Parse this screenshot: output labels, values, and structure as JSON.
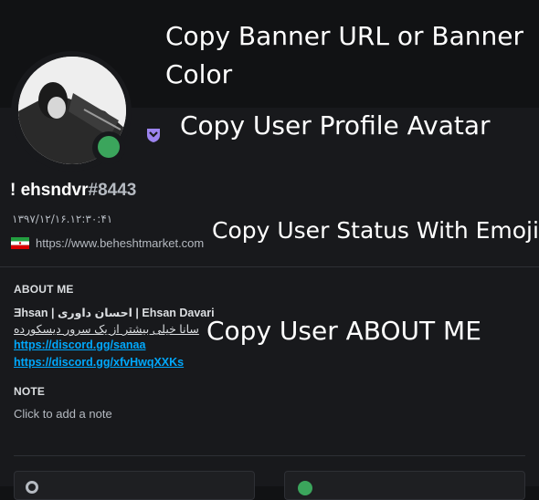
{
  "banner": {
    "caption": "Copy Banner URL or Banner Color"
  },
  "captions": {
    "avatar": "Copy User Profile Avatar",
    "status": "Copy User Status With Emoji",
    "about": "Copy User ABOUT ME"
  },
  "user": {
    "name": "! ehsndvr",
    "discriminator": "#8443",
    "online_color": "#3ba55c",
    "badge_icon": "hypesquad-badge-icon"
  },
  "status": {
    "date_text": "۱۳۹۷/۱۲/۱۶.۱۲:۳۰:۴۱",
    "flag_icon": "iran-flag-icon",
    "url": "https://www.beheshtmarket.com"
  },
  "about": {
    "title": "ABOUT ME",
    "line1": "Ǝhsan | احسان داوری | Ehsan Davari",
    "line2": "سانا خیلی بیشتر از یک سرور دیسکورده",
    "links": [
      "https://discord.gg/sanaa",
      "https://discord.gg/xfvHwqXXKs"
    ],
    "link_color": "#00a8fc"
  },
  "note": {
    "title": "NOTE",
    "placeholder": "Click to add a note"
  }
}
